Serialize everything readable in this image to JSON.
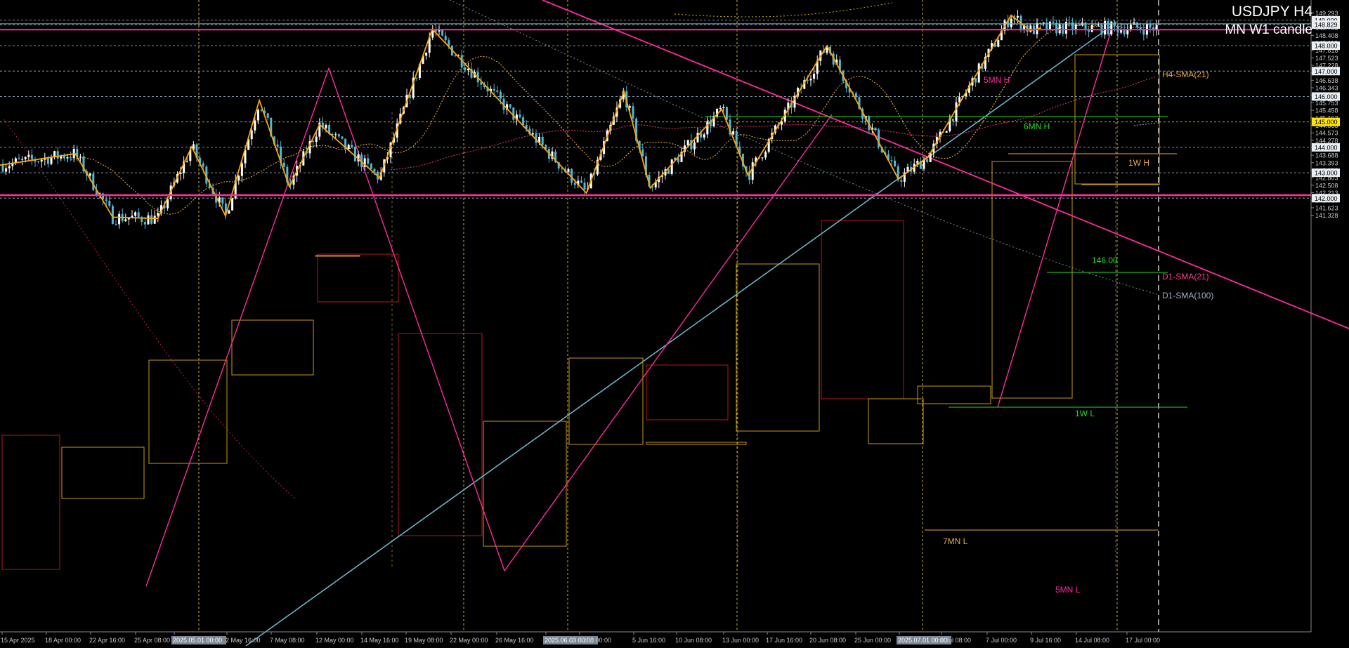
{
  "header": {
    "title": "USDJPY H4",
    "subtitle": "MN W1 candle"
  },
  "chart_data": {
    "type": "candlestick",
    "symbol": "USDJPY",
    "timeframe": "H4",
    "ylim": [
      141.26,
      149.42
    ],
    "price_ticks": [
      "149.293",
      "148.998",
      "148.703",
      "148.408",
      "148.113",
      "147.818",
      "147.523",
      "147.228",
      "146.933",
      "146.638",
      "146.343",
      "146.048",
      "145.753",
      "145.458",
      "145.163",
      "144.868",
      "144.573",
      "144.278",
      "143.983",
      "143.688",
      "143.393",
      "143.098",
      "142.803",
      "142.508",
      "142.213",
      "141.918",
      "141.623",
      "141.328"
    ],
    "price_ruler": [
      "149.293",
      "149.000",
      "148.999",
      "148.829",
      "148.703",
      "148.408",
      "148.113",
      "148.000",
      "147.818",
      "147.523",
      "147.228",
      "147.000",
      "146.933",
      "146.638",
      "146.343",
      "146.048",
      "146.000",
      "145.753",
      "145.458",
      "145.163",
      "145.000",
      "144.868",
      "144.573",
      "144.278",
      "144.000",
      "143.983",
      "143.688",
      "143.393",
      "143.098",
      "143.000",
      "142.803",
      "142.508",
      "142.213",
      "142.000",
      "141.918",
      "141.623",
      "141.328"
    ],
    "time_labels": [
      "15 Apr 2025",
      "18 Apr 00:00",
      "22 Apr 16:00",
      "25 Apr 08:00",
      "2025.05.01 00:00",
      "2 May 16:00",
      "7 May 08:00",
      "12 May 00:00",
      "14 May 16:00",
      "19 May 08:00",
      "22 May 00:00",
      "26 May 16:00",
      "2025.06.03 00:00",
      "3 Jun 00:00",
      "5 Jun 16:00",
      "10 Jun 08:00",
      "13 Jun 00:00",
      "17 Jun 16:00",
      "20 Jun 08:00",
      "25 Jun 00:00",
      "2025.07.01 00:00",
      "1 Jul 08:00",
      "7 Jul 00:00",
      "9 Jul 16:00",
      "14 Jul 08:00",
      "17 Jul 00:00"
    ],
    "price_markers": [
      {
        "price": 149.0,
        "label": "149.000"
      },
      {
        "price": 148.829,
        "label": "148.829"
      },
      {
        "price": 148.0,
        "label": "148.000"
      },
      {
        "price": 147.0,
        "label": "147.000"
      },
      {
        "price": 146.0,
        "label": "146.000"
      },
      {
        "price": 145.0,
        "label": "145.000"
      },
      {
        "price": 144.0,
        "label": "144.000"
      },
      {
        "price": 143.0,
        "label": "143.000"
      },
      {
        "price": 142.0,
        "label": "142.000"
      }
    ],
    "levels": [
      {
        "label": "5MN H",
        "price": 148.63,
        "color": "#ff2a9d"
      },
      {
        "label": "6MN H",
        "price": 148.07,
        "color": "#22dd22"
      },
      {
        "label": "1W H",
        "price": 147.55,
        "color": "#e8a93a"
      },
      {
        "label": "146.00",
        "price": 146.03,
        "color": "#22dd22"
      },
      {
        "label": "1W L",
        "price": 144.32,
        "color": "#22dd22"
      },
      {
        "label": "7MN L",
        "price": 142.71,
        "color": "#e8a93a"
      },
      {
        "label": "5MN L",
        "price": 142.12,
        "color": "#ff2a9d"
      }
    ],
    "indicators": [
      {
        "name": "H4-SMA(21)",
        "color": "#e8a93a"
      },
      {
        "name": "D1-SMA(21)",
        "color": "#ff3b8e"
      },
      {
        "name": "D1-SMA(100)",
        "color": "#9bb3c2"
      }
    ],
    "zigzag": [
      [
        0.0,
        143.3
      ],
      [
        0.2,
        143.75
      ],
      [
        0.3,
        141.25
      ],
      [
        0.42,
        141.2
      ],
      [
        0.51,
        144.02
      ],
      [
        0.6,
        141.3
      ],
      [
        0.69,
        145.85
      ],
      [
        0.77,
        142.45
      ],
      [
        0.85,
        144.9
      ],
      [
        1.01,
        142.8
      ],
      [
        1.15,
        148.65
      ],
      [
        1.56,
        142.2
      ],
      [
        1.66,
        146.2
      ],
      [
        1.73,
        142.4
      ],
      [
        1.92,
        145.5
      ],
      [
        1.99,
        142.9
      ],
      [
        2.2,
        148.0
      ],
      [
        2.39,
        142.75
      ],
      [
        2.47,
        143.65
      ],
      [
        2.69,
        149.2
      ],
      [
        2.74,
        148.6
      ],
      [
        2.77,
        148.7
      ]
    ]
  },
  "colors": {
    "background": "#000000",
    "bull": "#ffffff",
    "bear": "#4fb9d6",
    "grid": "#5a5a5a",
    "monthly_box": "#b8141e",
    "weekly_box": "#c99a16"
  }
}
